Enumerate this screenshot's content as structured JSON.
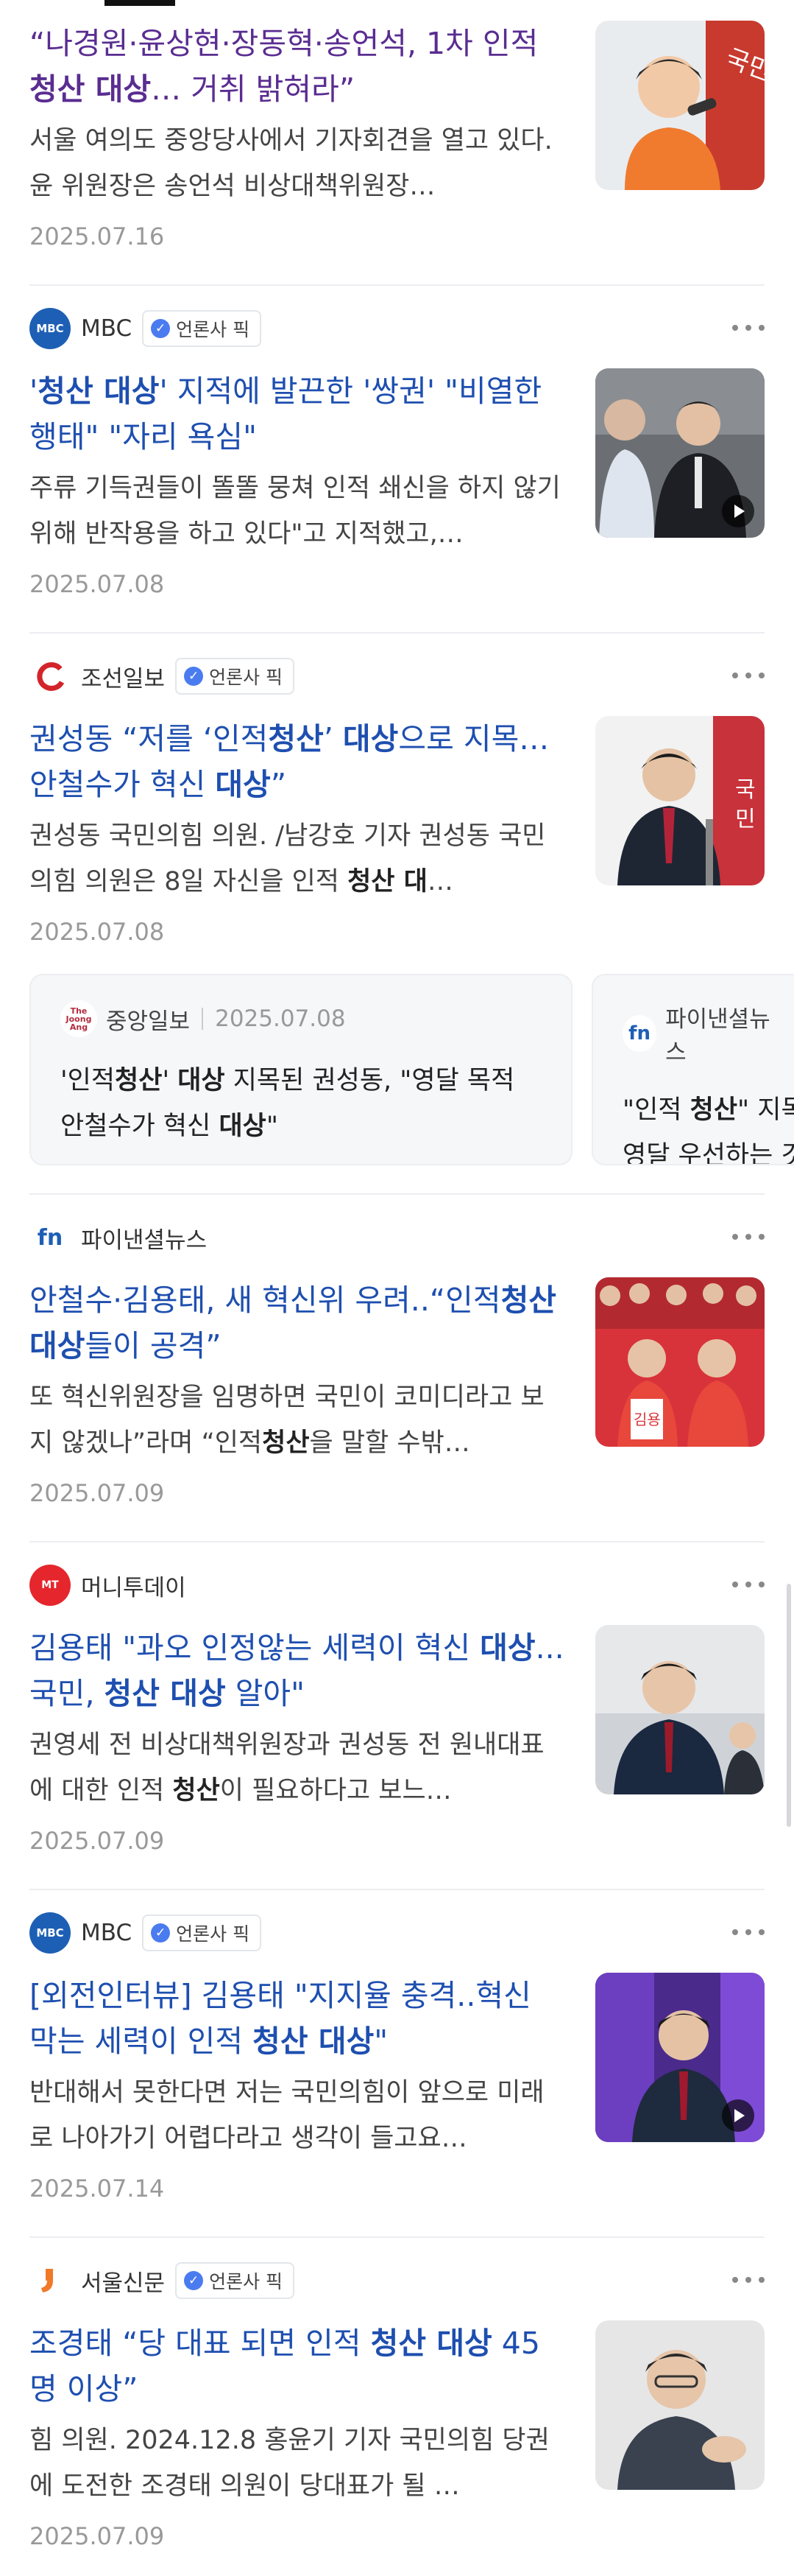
{
  "colors": {
    "link": "#1e4fb0",
    "visited": "#5a2d91",
    "date": "#999999",
    "badge_check": "#4a7cf0"
  },
  "articles": [
    {
      "source": "",
      "title_parts": [
        {
          "t": "“나경원·윤상현·장동혁·송언석, 1차 인적 "
        },
        {
          "t": "청산 대상",
          "b": true
        },
        {
          "t": "… 거취 밝혀라”"
        }
      ],
      "desc_parts": [
        {
          "t": "서울 여의도 중앙당사에서 기자회견을 열고 있다. 윤 위원장은 송언석 비상대책위원장…"
        }
      ],
      "date": "2025.07.16"
    },
    {
      "source": "MBC",
      "badge": "언론사 픽",
      "title_parts": [
        {
          "t": "'"
        },
        {
          "t": "청산 대상",
          "b": true
        },
        {
          "t": "' 지적에 발끈한 '쌍권' \"비열한 행태\" \"자리 욕심\""
        }
      ],
      "desc_parts": [
        {
          "t": "주류 기득권들이 똘똘 뭉쳐 인적 쇄신을 하지 않기 위해 반작용을 하고 있다\"고 지적했고,…"
        }
      ],
      "date": "2025.07.08"
    },
    {
      "source": "조선일보",
      "badge": "언론사 픽",
      "title_parts": [
        {
          "t": "권성동 “저를 ‘인적"
        },
        {
          "t": "청산",
          "b": true
        },
        {
          "t": "’ "
        },
        {
          "t": "대상",
          "b": true
        },
        {
          "t": "으로 지목… 안철수가 혁신 "
        },
        {
          "t": "대상",
          "b": true
        },
        {
          "t": "”"
        }
      ],
      "desc_parts": [
        {
          "t": "권성동 국민의힘 의원. /남강호 기자 권성동 국민의힘 의원은 8일 자신을 인적 "
        },
        {
          "t": "청산 대",
          "b": true
        },
        {
          "t": "…"
        }
      ],
      "date": "2025.07.08"
    },
    {
      "source": "파이낸셜뉴스",
      "title_parts": [
        {
          "t": "안철수·김용태, 새 혁신위 우려..“인적"
        },
        {
          "t": "청산 대상",
          "b": true
        },
        {
          "t": "들이 공격”"
        }
      ],
      "desc_parts": [
        {
          "t": "또 혁신위원장을 임명하면 국민이 코미디라고 보지 않겠나”라며 “인적"
        },
        {
          "t": "청산",
          "b": true
        },
        {
          "t": "을 말할 수밖…"
        }
      ],
      "date": "2025.07.09"
    },
    {
      "source": "머니투데이",
      "title_parts": [
        {
          "t": "김용태 \"과오 인정않는 세력이 혁신 "
        },
        {
          "t": "대상",
          "b": true
        },
        {
          "t": "...국민, "
        },
        {
          "t": "청산 대상",
          "b": true
        },
        {
          "t": " 알아\""
        }
      ],
      "desc_parts": [
        {
          "t": "권영세 전 비상대책위원장과 권성동 전 원내대표에 대한 인적 "
        },
        {
          "t": "청산",
          "b": true
        },
        {
          "t": "이 필요하다고 보느…"
        }
      ],
      "date": "2025.07.09"
    },
    {
      "source": "MBC",
      "badge": "언론사 픽",
      "title_parts": [
        {
          "t": "[외전인터뷰] 김용태 \"지지율 충격..혁신 막는 세력이 인적 "
        },
        {
          "t": "청산 대상",
          "b": true
        },
        {
          "t": "\""
        }
      ],
      "desc_parts": [
        {
          "t": "반대해서 못한다면 저는 국민의힘이 앞으로 미래로 나아가기 어렵다라고 생각이 들고요…"
        }
      ],
      "date": "2025.07.14"
    },
    {
      "source": "서울신문",
      "badge": "언론사 픽",
      "title_parts": [
        {
          "t": "조경태 “당 대표 되면 인적 "
        },
        {
          "t": "청산 대상",
          "b": true
        },
        {
          "t": " 45명 이상”"
        }
      ],
      "desc_parts": [
        {
          "t": "힘 의원. 2024.12.8 홍윤기 기자 국민의힘 당권에 도전한 조경태 의원이 당대표가 될 …"
        }
      ],
      "date": "2025.07.09"
    }
  ],
  "related": [
    {
      "source": "중앙일보",
      "date": "2025.07.08",
      "title_parts": [
        {
          "t": "'인적"
        },
        {
          "t": "청산",
          "b": true
        },
        {
          "t": "' "
        },
        {
          "t": "대상",
          "b": true
        },
        {
          "t": " 지목된 권성동, \"영달 목적 안철수가 혁신 "
        },
        {
          "t": "대상",
          "b": true
        },
        {
          "t": "\""
        }
      ]
    },
    {
      "source": "파이낸셜뉴스",
      "title_parts": [
        {
          "t": "\"인적 "
        },
        {
          "t": "청산",
          "b": true
        },
        {
          "t": "\" 지목… 영달 우선하는 것"
        }
      ]
    }
  ]
}
